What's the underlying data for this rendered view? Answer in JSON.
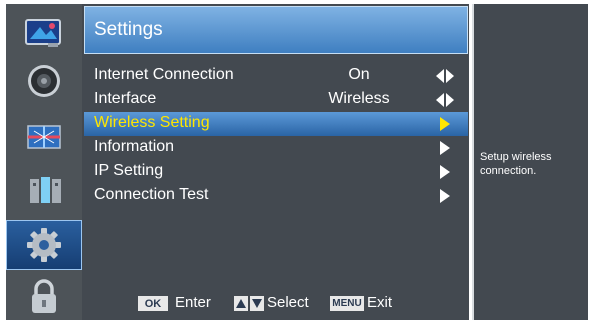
{
  "sidebar": {
    "items": [
      {
        "name": "picture-icon"
      },
      {
        "name": "sound-icon"
      },
      {
        "name": "channel-icon"
      },
      {
        "name": "network-icon"
      },
      {
        "name": "settings-gear-icon",
        "active": true
      },
      {
        "name": "lock-icon"
      }
    ]
  },
  "header": {
    "title": "Settings"
  },
  "menu": {
    "items": [
      {
        "label": "Internet Connection",
        "value": "On",
        "control": "left-right-arrows-icon"
      },
      {
        "label": "Interface",
        "value": "Wireless",
        "control": "left-right-arrows-icon"
      },
      {
        "label": "Wireless Setting",
        "value": "",
        "control": "right-arrow-icon",
        "selected": true
      },
      {
        "label": "Information",
        "value": "",
        "control": "right-arrow-icon"
      },
      {
        "label": "IP Setting",
        "value": "",
        "control": "right-arrow-icon"
      },
      {
        "label": "Connection Test",
        "value": "",
        "control": "right-arrow-icon"
      }
    ]
  },
  "footer": {
    "ok_key": "OK",
    "enter_label": "Enter",
    "select_label": "Select",
    "menu_key": "MENU",
    "exit_label": "Exit"
  },
  "help": {
    "text": "Setup wireless connection."
  },
  "colors": {
    "selected_text": "#ffe600",
    "accent": "#3f7fc1",
    "panel": "#434950"
  }
}
